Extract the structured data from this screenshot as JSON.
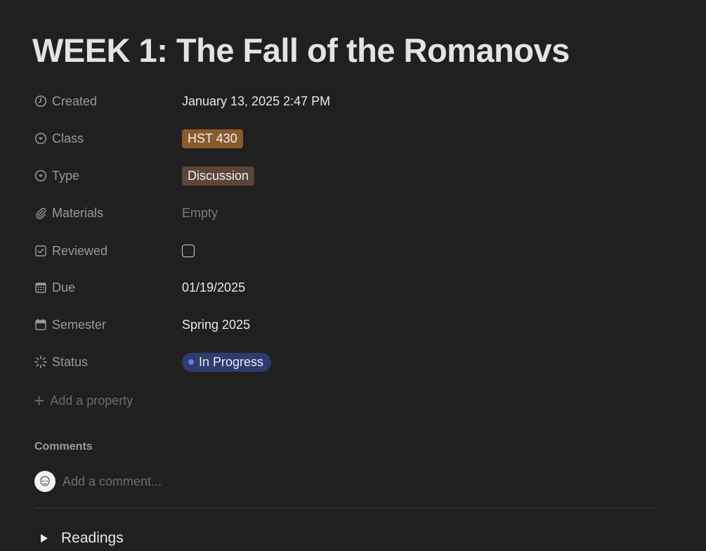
{
  "title": "WEEK 1: The Fall of the Romanovs",
  "properties": {
    "created": {
      "label": "Created",
      "icon": "clock-icon",
      "value": "January 13, 2025 2:47 PM"
    },
    "class": {
      "label": "Class",
      "icon": "select-icon",
      "value": "HST 430",
      "color": "#8a5a2b"
    },
    "type": {
      "label": "Type",
      "icon": "select-icon",
      "value": "Discussion",
      "color": "#5c4437"
    },
    "materials": {
      "label": "Materials",
      "icon": "paperclip-icon",
      "value": "Empty"
    },
    "reviewed": {
      "label": "Reviewed",
      "icon": "checkbox-icon",
      "checked": false
    },
    "due": {
      "label": "Due",
      "icon": "calendar-grid-icon",
      "value": "01/19/2025"
    },
    "semester": {
      "label": "Semester",
      "icon": "calendar-icon",
      "value": "Spring 2025"
    },
    "status": {
      "label": "Status",
      "icon": "status-spinner-icon",
      "value": "In Progress",
      "color": "#2f3b6b",
      "dot_color": "#5b7bf0"
    }
  },
  "add_property": {
    "label": "Add a property",
    "icon": "plus-icon"
  },
  "comments": {
    "heading": "Comments",
    "placeholder": "Add a comment..."
  },
  "toggle": {
    "label": "Readings",
    "icon": "triangle-right-icon"
  }
}
